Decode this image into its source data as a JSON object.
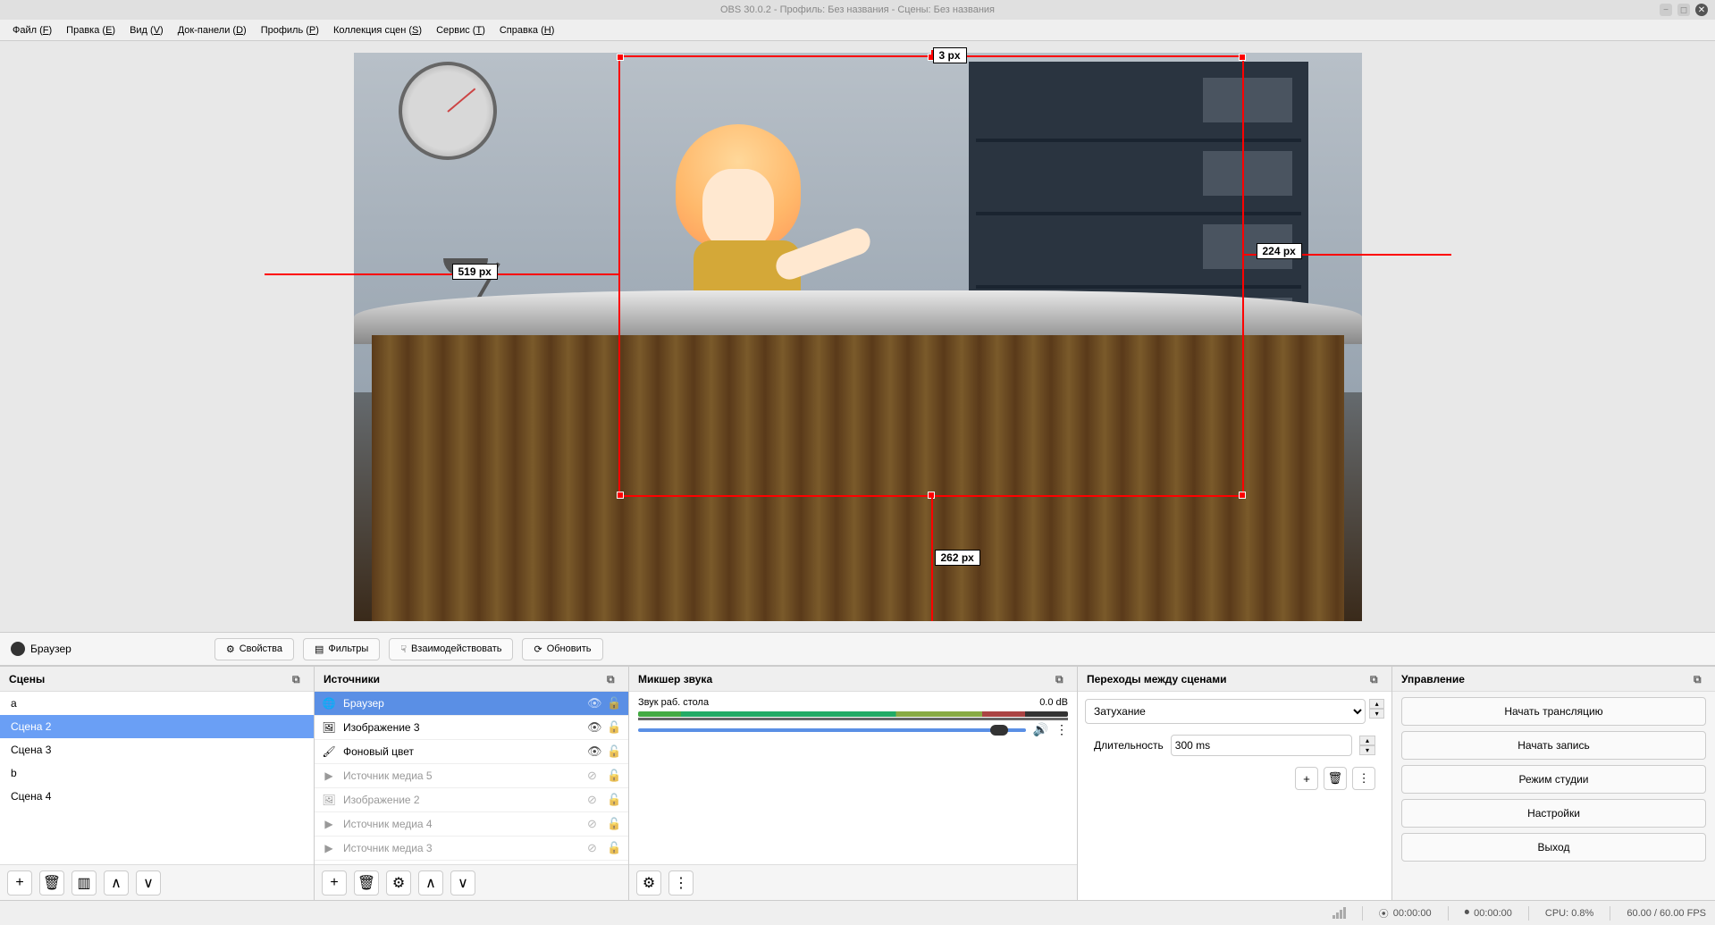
{
  "window": {
    "title": "OBS 30.0.2 - Профиль: Без названия - Сцены: Без названия"
  },
  "menubar": {
    "items": [
      {
        "label": "Файл (",
        "key": "F",
        "suffix": ")"
      },
      {
        "label": "Правка (",
        "key": "E",
        "suffix": ")"
      },
      {
        "label": "Вид (",
        "key": "V",
        "suffix": ")"
      },
      {
        "label": "Док-панели (",
        "key": "D",
        "suffix": ")"
      },
      {
        "label": "Профиль (",
        "key": "P",
        "suffix": ")"
      },
      {
        "label": "Коллекция сцен (",
        "key": "S",
        "suffix": ")"
      },
      {
        "label": "Сервис (",
        "key": "T",
        "suffix": ")"
      },
      {
        "label": "Справка (",
        "key": "H",
        "suffix": ")"
      }
    ]
  },
  "preview": {
    "guides": {
      "top": "3 px",
      "left": "519 px",
      "right": "224 px",
      "bottom": "262 px"
    }
  },
  "context_toolbar": {
    "source_label": "Браузер",
    "properties": "Свойства",
    "filters": "Фильтры",
    "interact": "Взаимодействовать",
    "refresh": "Обновить"
  },
  "docks": {
    "scenes": {
      "title": "Сцены",
      "items": [
        {
          "name": "a",
          "selected": false
        },
        {
          "name": "Сцена 2",
          "selected": true
        },
        {
          "name": "Сцена 3",
          "selected": false
        },
        {
          "name": "b",
          "selected": false
        },
        {
          "name": "Сцена 4",
          "selected": false
        }
      ]
    },
    "sources": {
      "title": "Источники",
      "items": [
        {
          "name": "Браузер",
          "icon": "globe",
          "visible": true,
          "locked": false,
          "selected": true
        },
        {
          "name": "Изображение 3",
          "icon": "image",
          "visible": true,
          "locked": false,
          "selected": false
        },
        {
          "name": "Фоновый цвет",
          "icon": "brush",
          "visible": true,
          "locked": false,
          "selected": false
        },
        {
          "name": "Источник медиа 5",
          "icon": "play",
          "visible": false,
          "locked": false,
          "selected": false
        },
        {
          "name": "Изображение 2",
          "icon": "image",
          "visible": false,
          "locked": false,
          "selected": false
        },
        {
          "name": "Источник медиа 4",
          "icon": "play",
          "visible": false,
          "locked": false,
          "selected": false
        },
        {
          "name": "Источник медиа 3",
          "icon": "play",
          "visible": false,
          "locked": false,
          "selected": false
        }
      ]
    },
    "mixer": {
      "title": "Микшер звука",
      "channels": [
        {
          "name": "Звук раб. стола",
          "level": "0.0 dB"
        }
      ]
    },
    "transitions": {
      "title": "Переходы между сценами",
      "current": "Затухание",
      "duration_label": "Длительность",
      "duration_value": "300 ms"
    },
    "controls": {
      "title": "Управление",
      "buttons": {
        "stream": "Начать трансляцию",
        "record": "Начать запись",
        "studio": "Режим студии",
        "settings": "Настройки",
        "exit": "Выход"
      }
    }
  },
  "statusbar": {
    "live_time": "00:00:00",
    "rec_time": "00:00:00",
    "cpu": "CPU: 0.8%",
    "fps": "60.00 / 60.00 FPS"
  }
}
